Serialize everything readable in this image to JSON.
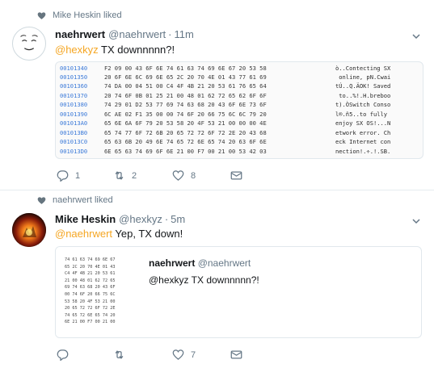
{
  "tweet1": {
    "liked_by": "Mike Heskin liked",
    "author_name": "naehrwert",
    "author_handle": "@naehrwert",
    "time": "11m",
    "reply_to": "@hexkyz",
    "text": " TX downnnnn?!",
    "hexdump": [
      {
        "addr": "00101340",
        "bytes": "F2 09 00 43 6F 6E 74 61 63 74 69 6E 67 20 53 58",
        "ascii": "ò..Contecting SX"
      },
      {
        "addr": "00101350",
        "bytes": "20 6F 6E 6C 69 6E 65 2C 20 70 4E 01 43 77 61 69",
        "ascii": " online, pN.Cwai"
      },
      {
        "addr": "00101360",
        "bytes": "74 DA 00 04 51 00 C4 4F 4B 21 20 53 61 76 65 64",
        "ascii": "tÚ..Q.ÄOK! Saved"
      },
      {
        "addr": "00101370",
        "bytes": "20 74 6F 0B 01 25 21 00 48 01 62 72 65 62 6F 6F",
        "ascii": " to..%!.H.breboo"
      },
      {
        "addr": "00101380",
        "bytes": "74 29 01 D2 53 77 69 74 63 68 20 43 6F 6E 73 6F",
        "ascii": "t).ÒSwitch Conso"
      },
      {
        "addr": "00101390",
        "bytes": "6C AE 02 F1 35 00 00 74 6F 20 66 75 6C 6C 79 20",
        "ascii": "l®.ñ5..to fully "
      },
      {
        "addr": "001013A0",
        "bytes": "65 6E 6A 6F 79 20 53 58 20 4F 53 21 00 00 00 4E",
        "ascii": "enjoy SX OS!...N"
      },
      {
        "addr": "001013B0",
        "bytes": "65 74 77 6F 72 6B 20 65 72 72 6F 72 2E 20 43 68",
        "ascii": "etwork error. Ch"
      },
      {
        "addr": "001013C0",
        "bytes": "65 63 6B 20 49 6E 74 65 72 6E 65 74 20 63 6F 6E",
        "ascii": "eck Internet con"
      },
      {
        "addr": "001013D0",
        "bytes": "6E 65 63 74 69 6F 6E 21 00 F7 00 21 00 53 42 03",
        "ascii": "nection!.÷.!.SB."
      }
    ],
    "actions": {
      "replies": "1",
      "retweets": "2",
      "likes": "8"
    }
  },
  "tweet2": {
    "liked_by": "naehrwert liked",
    "author_name": "Mike Heskin",
    "author_handle": "@hexkyz",
    "time": "5m",
    "reply_to": "@naehrwert",
    "text": " Yep, TX down!",
    "quote": {
      "author_name": "naehrwert",
      "author_handle": "@naehrwert",
      "text": "@hexkyz TX downnnnn?!",
      "thumb_lines": [
        "74 61 63 74 69 6E 67",
        "65 2C 20 70 4E 01 43",
        "C4 4F 4B 21 20 53 61",
        "21 00 48 01 62 72 65",
        "69 74 63 68 20 43 6F",
        "00 74 6F 20 66 75 6C",
        "53 58 20 4F 53 21 00",
        "20 65 72 72 6F 72 2E",
        "74 65 72 6E 65 74 20",
        "6E 21 00 F7 00 21 00"
      ]
    },
    "actions": {
      "replies": "",
      "retweets": "",
      "likes": "7"
    }
  },
  "colors": {
    "accent": "#f5a623",
    "meta": "#657786",
    "link": "#3b7ad9",
    "like_heart": "#7a8a99"
  }
}
